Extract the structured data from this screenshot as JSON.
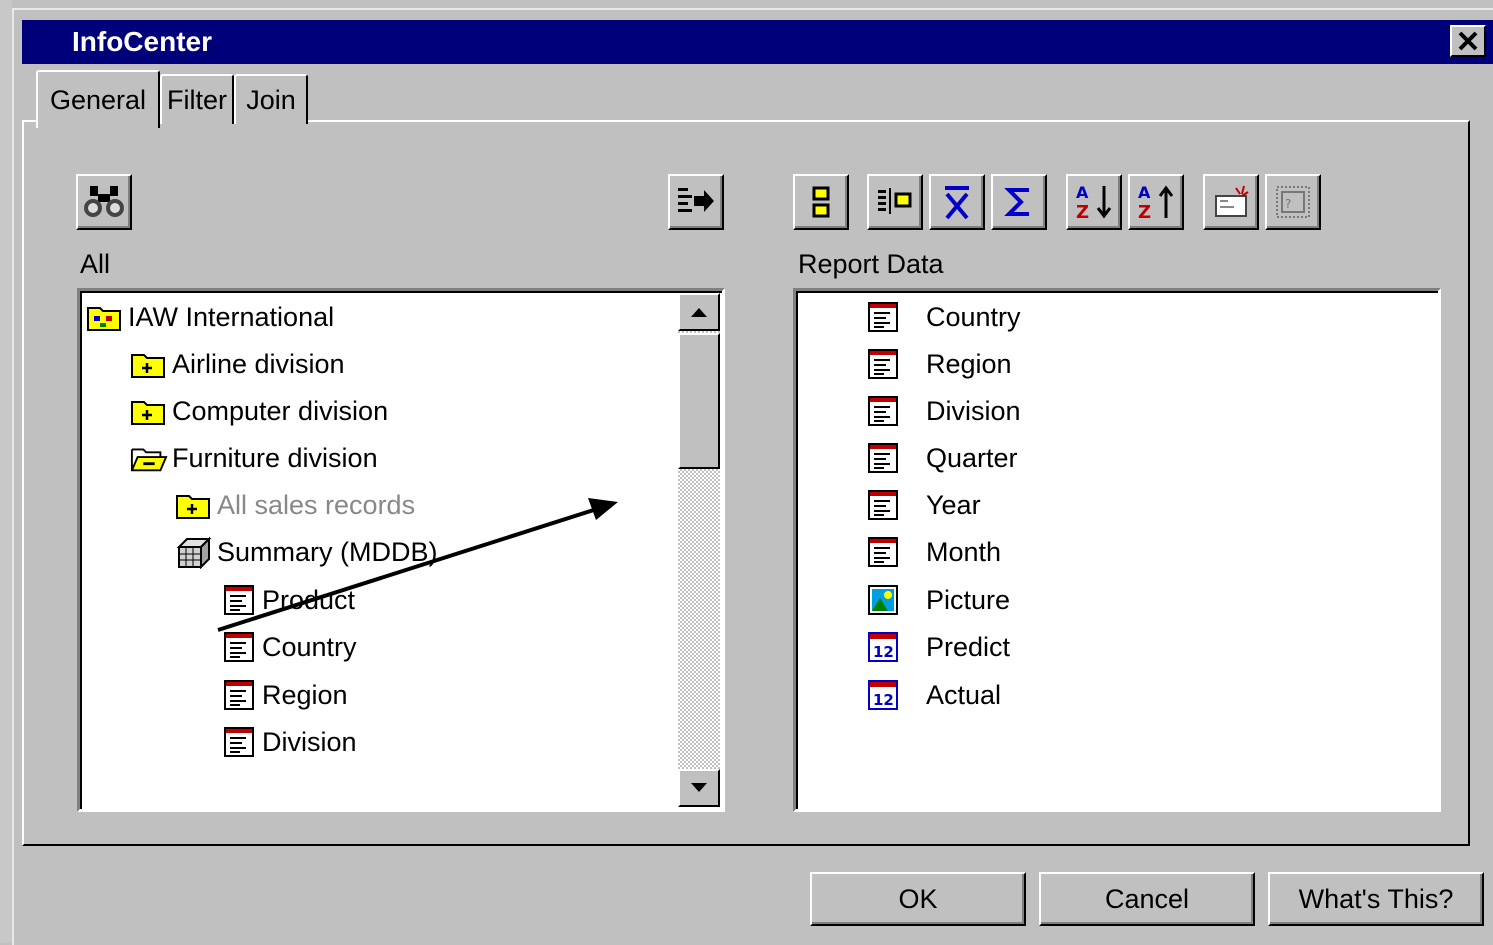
{
  "window": {
    "title": "InfoCenter"
  },
  "tabs": [
    {
      "label": "General"
    },
    {
      "label": "Filter"
    },
    {
      "label": "Join"
    }
  ],
  "left": {
    "label": "All",
    "tree": [
      {
        "label": "IAW International",
        "icon": "org-folder-icon",
        "enabled": true
      },
      {
        "label": "Airline division",
        "icon": "folder-plus-icon",
        "enabled": true
      },
      {
        "label": "Computer division",
        "icon": "folder-plus-icon",
        "enabled": true
      },
      {
        "label": "Furniture division",
        "icon": "folder-open-minus-icon",
        "enabled": true
      },
      {
        "label": "All sales records",
        "icon": "folder-plus-icon",
        "enabled": false
      },
      {
        "label": "Summary (MDDB)",
        "icon": "cube-icon",
        "enabled": true
      },
      {
        "label": "Product",
        "icon": "text-field-icon",
        "enabled": true
      },
      {
        "label": "Country",
        "icon": "text-field-icon",
        "enabled": true
      },
      {
        "label": "Region",
        "icon": "text-field-icon",
        "enabled": true
      },
      {
        "label": "Division",
        "icon": "text-field-icon",
        "enabled": true
      }
    ]
  },
  "right": {
    "label": "Report Data",
    "items": [
      {
        "label": "Country",
        "icon": "text-field-icon"
      },
      {
        "label": "Region",
        "icon": "text-field-icon"
      },
      {
        "label": "Division",
        "icon": "text-field-icon"
      },
      {
        "label": "Quarter",
        "icon": "text-field-icon"
      },
      {
        "label": "Year",
        "icon": "text-field-icon"
      },
      {
        "label": "Month",
        "icon": "text-field-icon"
      },
      {
        "label": "Picture",
        "icon": "picture-field-icon"
      },
      {
        "label": "Predict",
        "icon": "numeric-field-icon"
      },
      {
        "label": "Actual",
        "icon": "numeric-field-icon"
      }
    ]
  },
  "buttons": {
    "ok": "OK",
    "cancel": "Cancel",
    "help": "What's This?"
  },
  "colors": {
    "titlebar": "#00007a",
    "face": "#c0c0c0",
    "accent_blue": "#0000c8",
    "icon_red": "#c00000"
  }
}
